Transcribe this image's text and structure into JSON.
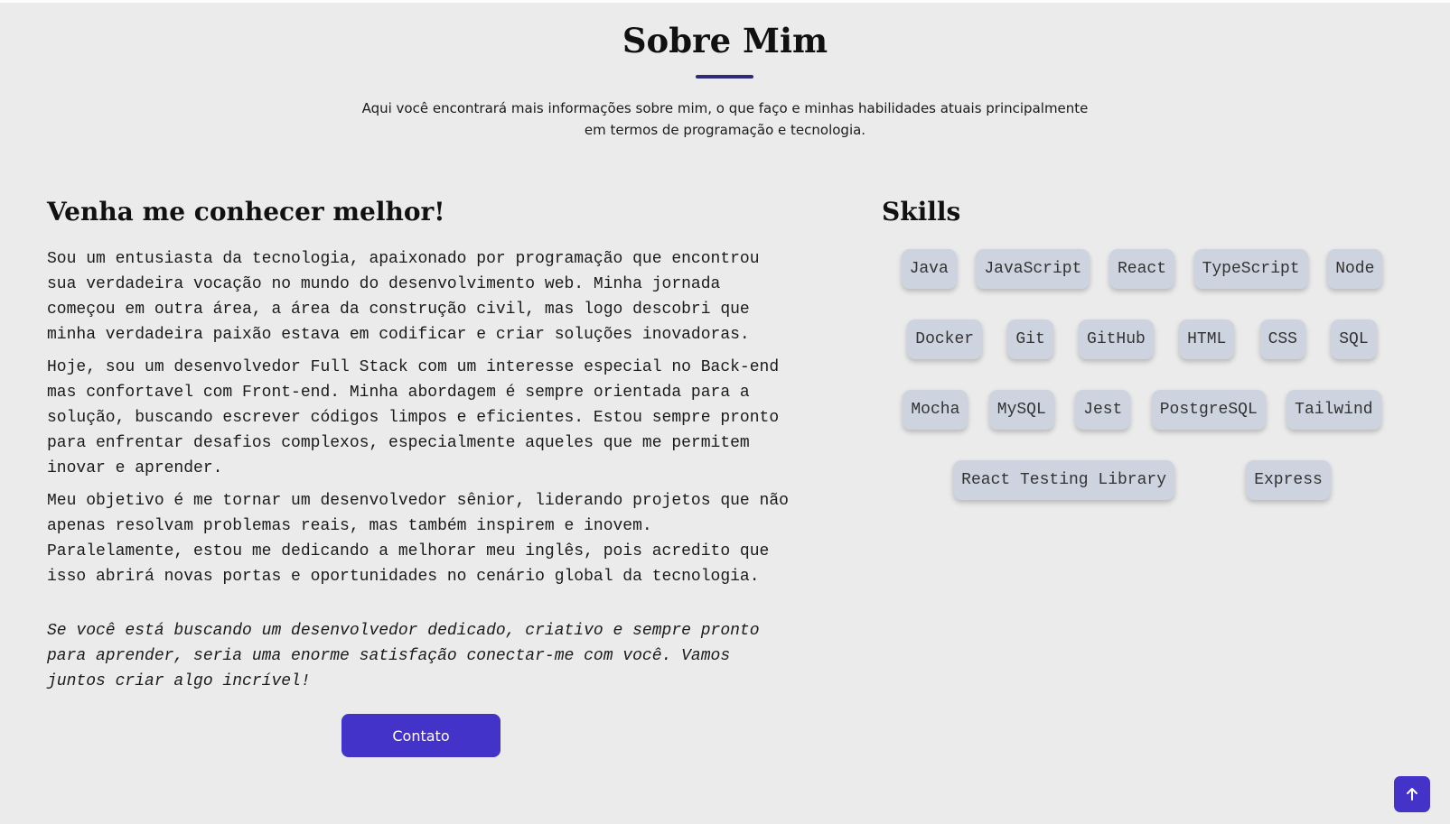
{
  "header": {
    "title": "Sobre Mim",
    "intro": "Aqui você encontrará mais informações sobre mim, o que faço e minhas habilidades atuais principalmente em termos de programação e tecnologia."
  },
  "about": {
    "heading": "Venha me conhecer melhor!",
    "paragraphs": [
      "Sou um entusiasta da tecnologia, apaixonado por programação que encontrou sua verdadeira vocação no mundo do desenvolvimento web. Minha jornada começou em outra área, a área da construção civil, mas logo descobri que minha verdadeira paixão estava em codificar e criar soluções inovadoras.",
      "Hoje, sou um desenvolvedor Full Stack com um interesse especial no Back-end mas confortavel com Front-end. Minha abordagem é sempre orientada para a solução, buscando escrever códigos limpos e eficientes. Estou sempre pronto para enfrentar desafios complexos, especialmente aqueles que me permitem inovar e aprender.",
      "Meu objetivo é me tornar um desenvolvedor sênior, liderando projetos que não apenas resolvam problemas reais, mas também inspirem e inovem. Paralelamente, estou me dedicando a melhorar meu inglês, pois acredito que isso abrirá novas portas e oportunidades no cenário global da tecnologia.",
      "Se você está buscando um desenvolvedor dedicado, criativo e sempre pronto para aprender, seria uma enorme satisfação conectar-me com você. Vamos juntos criar algo incrível!"
    ],
    "contact_button": "Contato"
  },
  "skills": {
    "heading": "Skills",
    "rows": [
      [
        "Java",
        "JavaScript",
        "React",
        "TypeScript",
        "Node"
      ],
      [
        "Docker",
        "Git",
        "GitHub",
        "HTML",
        "CSS",
        "SQL"
      ],
      [
        "Mocha",
        "MySQL",
        "Jest",
        "PostgreSQL",
        "Tailwind"
      ],
      [
        "React Testing Library",
        "Express"
      ]
    ]
  },
  "scroll_top": {
    "icon": "arrow-up-icon"
  },
  "colors": {
    "accent": "#4433c8",
    "underline": "#2f2a7a",
    "background": "#ebebeb",
    "chip": "#cdd4df"
  }
}
